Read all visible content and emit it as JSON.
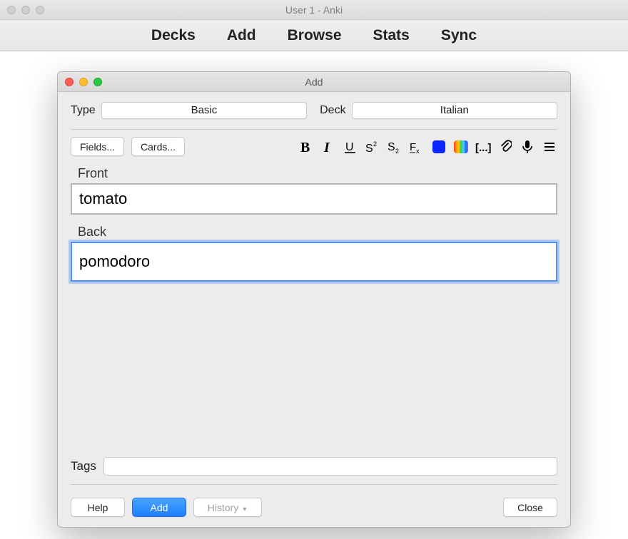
{
  "main_window": {
    "title": "User 1 - Anki",
    "toolbar": {
      "decks": "Decks",
      "add": "Add",
      "browse": "Browse",
      "stats": "Stats",
      "sync": "Sync"
    }
  },
  "dialog": {
    "title": "Add",
    "type_label": "Type",
    "type_value": "Basic",
    "deck_label": "Deck",
    "deck_value": "Italian",
    "fields_button": "Fields...",
    "cards_button": "Cards...",
    "front_label": "Front",
    "front_value": "tomato",
    "back_label": "Back",
    "back_value": "pomodoro",
    "tags_label": "Tags",
    "tags_value": "",
    "help_button": "Help",
    "add_button": "Add",
    "history_button": "History",
    "close_button": "Close"
  }
}
